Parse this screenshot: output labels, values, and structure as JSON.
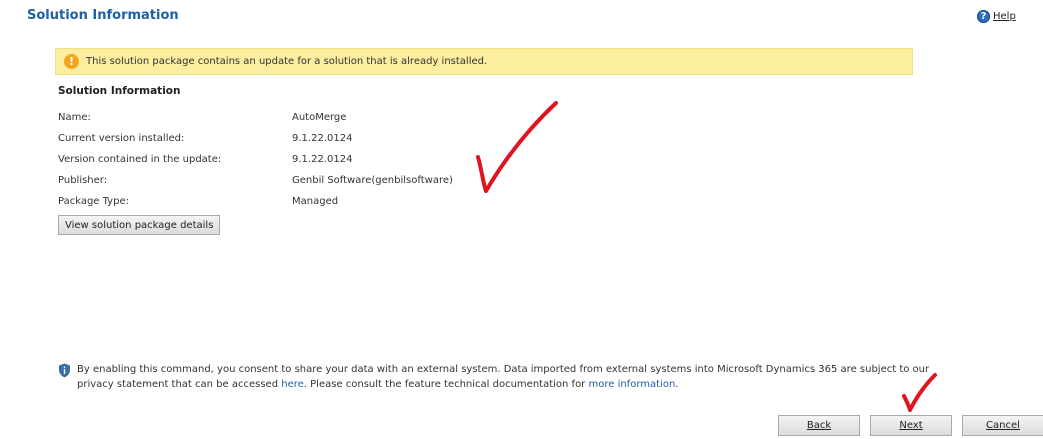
{
  "header": {
    "title": "Solution Information",
    "help_label": "Help"
  },
  "banner": {
    "message": "This solution package contains an update for a solution that is already installed."
  },
  "solution_info": {
    "heading": "Solution Information",
    "rows": [
      {
        "label": "Name:",
        "value": "AutoMerge"
      },
      {
        "label": "Current version installed:",
        "value": "9.1.22.0124"
      },
      {
        "label": "Version contained in the update:",
        "value": "9.1.22.0124"
      },
      {
        "label": "Publisher:",
        "value": "Genbil Software(genbilsoftware)"
      },
      {
        "label": "Package Type:",
        "value": "Managed"
      }
    ],
    "details_button": "View solution package details"
  },
  "consent": {
    "text_1": "By enabling this command, you consent to share your data with an external system. Data imported from external systems into Microsoft Dynamics 365 are subject to our privacy statement that can be accessed ",
    "link_1": "here",
    "text_2": ". Please consult the feature technical documentation for ",
    "link_2": "more information",
    "text_3": "."
  },
  "footer": {
    "back_label": "Back",
    "next_label": "Next",
    "cancel_label": "Cancel"
  },
  "colors": {
    "title_blue": "#1f5fa8",
    "banner_yellow": "#fbee9e",
    "warning_orange": "#f2a61c",
    "annotation_red": "#e0141e"
  }
}
